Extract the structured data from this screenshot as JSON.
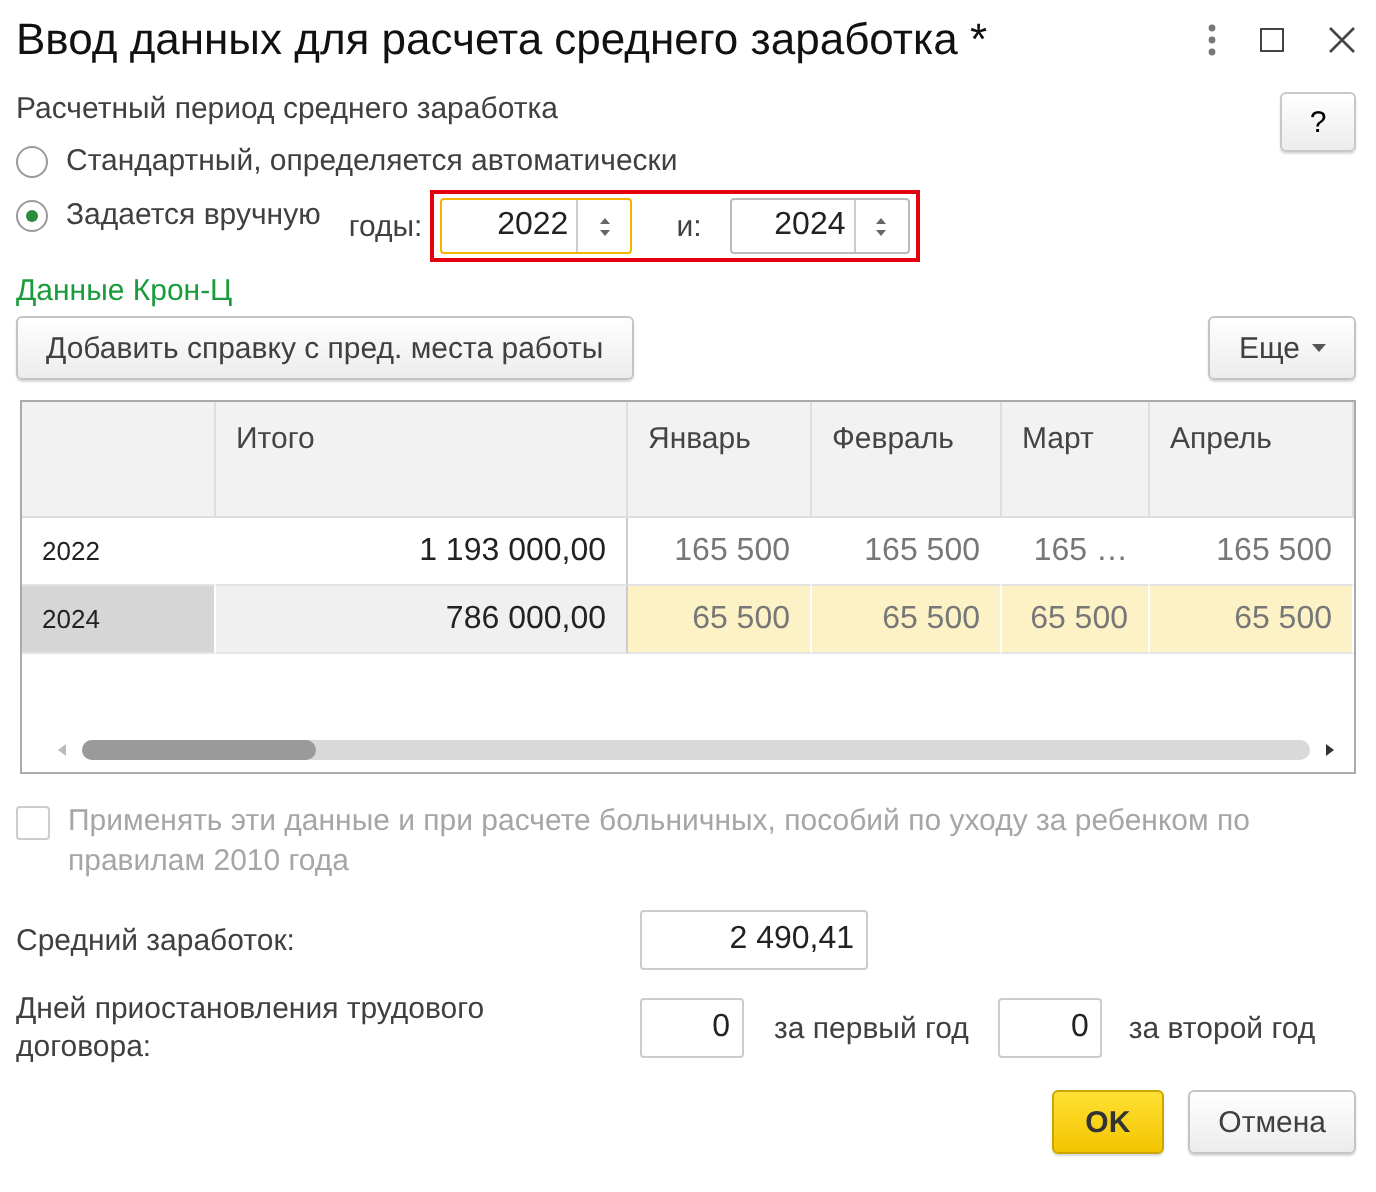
{
  "window": {
    "title": "Ввод данных для расчета среднего заработка *"
  },
  "help_button": "?",
  "period": {
    "label": "Расчетный период среднего заработка",
    "options": [
      {
        "label": "Стандартный, определяется автоматически",
        "selected": false
      },
      {
        "label": "Задается вручную",
        "selected": true
      }
    ],
    "years": {
      "highlighted": true,
      "label": "годы:",
      "separator": "и:",
      "fields": [
        {
          "value": "2022",
          "focused": true
        },
        {
          "value": "2024",
          "focused": false
        }
      ]
    }
  },
  "source_link": "Данные Крон-Ц",
  "toolbar": {
    "add_button": "Добавить справку с пред. места работы",
    "more_button": "Еще"
  },
  "table": {
    "columns": [
      "",
      "Итого",
      "Январь",
      "Февраль",
      "Март",
      "Апрель"
    ],
    "rows": [
      {
        "year": "2022",
        "total": "1 193 000,00",
        "months": [
          "165 500",
          "165 500",
          "165 …",
          "165 500"
        ],
        "selected": false
      },
      {
        "year": "2024",
        "total": "786 000,00",
        "months": [
          "65 500",
          "65 500",
          "65 500",
          "65 500"
        ],
        "selected": true
      }
    ]
  },
  "apply_checkbox": {
    "label": "Применять эти данные и при расчете больничных, пособий по уходу за ребенком по правилам 2010 года",
    "checked": false,
    "disabled": true
  },
  "average_earnings": {
    "label": "Средний заработок:",
    "value": "2 490,41"
  },
  "suspension": {
    "label": "Дней приостановления трудового договора:",
    "first_value": "0",
    "first_label": "за первый год",
    "second_value": "0",
    "second_label": "за второй год"
  },
  "buttons": {
    "ok": "OK",
    "cancel": "Отмена"
  }
}
